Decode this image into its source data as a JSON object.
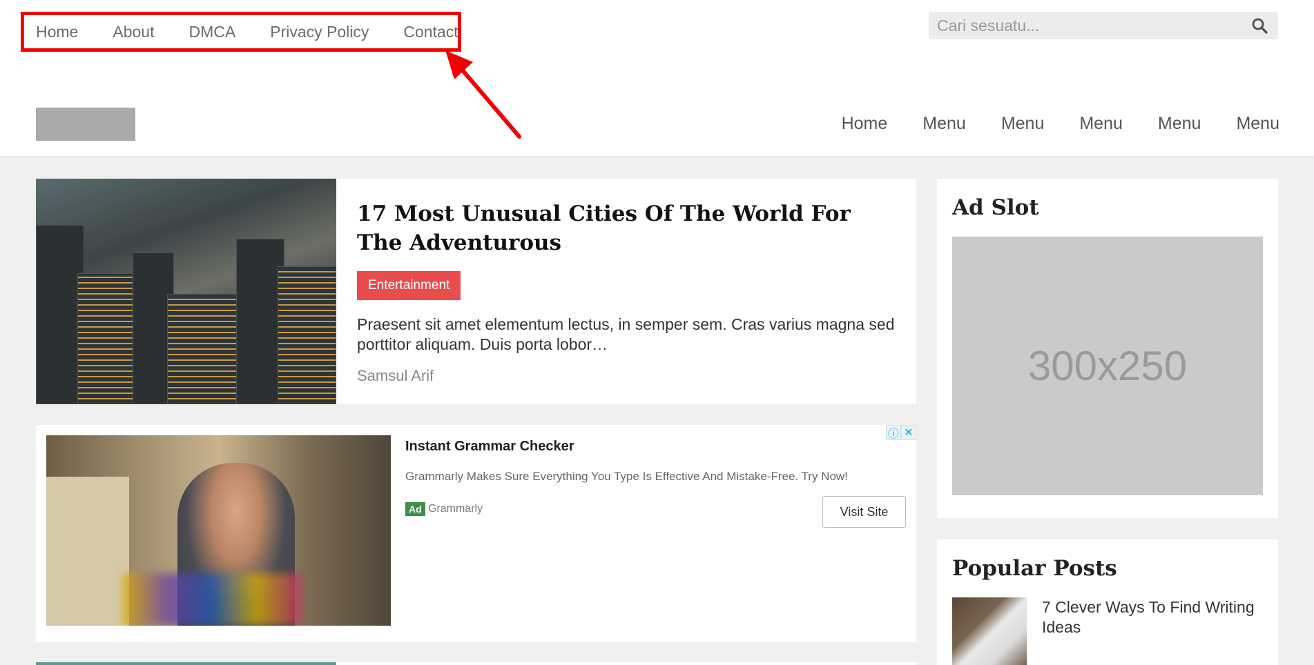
{
  "top_nav": {
    "items": [
      {
        "label": "Home"
      },
      {
        "label": "About"
      },
      {
        "label": "DMCA"
      },
      {
        "label": "Privacy Policy"
      },
      {
        "label": "Contact"
      }
    ]
  },
  "search": {
    "placeholder": "Cari sesuatu...",
    "icon": "search-icon"
  },
  "main_nav": {
    "items": [
      {
        "label": "Home"
      },
      {
        "label": "Menu"
      },
      {
        "label": "Menu"
      },
      {
        "label": "Menu"
      },
      {
        "label": "Menu"
      },
      {
        "label": "Menu"
      }
    ]
  },
  "post": {
    "title": "17 Most Unusual Cities Of The World For The Adventurous",
    "category": "Entertainment",
    "excerpt": "Praesent sit amet elementum lectus, in semper sem. Cras varius magna sed porttitor aliquam. Duis porta lobor…",
    "author": "Samsul Arif"
  },
  "ad": {
    "headline": "Instant Grammar Checker",
    "description": "Grammarly Makes Sure Everything You Type Is Effective And Mistake-Free. Try Now!",
    "badge": "Ad",
    "advertiser": "Grammarly",
    "cta": "Visit Site",
    "info_icon": "ⓘ",
    "close_icon": "✕"
  },
  "sidebar": {
    "ad_widget": {
      "title": "Ad Slot",
      "placeholder": "300x250"
    },
    "popular_widget": {
      "title": "Popular Posts",
      "items": [
        {
          "title": "7 Clever Ways To Find Writing Ideas"
        }
      ]
    }
  },
  "colors": {
    "highlight_border": "#f40000",
    "category_bg": "#e94c4c",
    "ad_badge": "#3d8f4c"
  }
}
